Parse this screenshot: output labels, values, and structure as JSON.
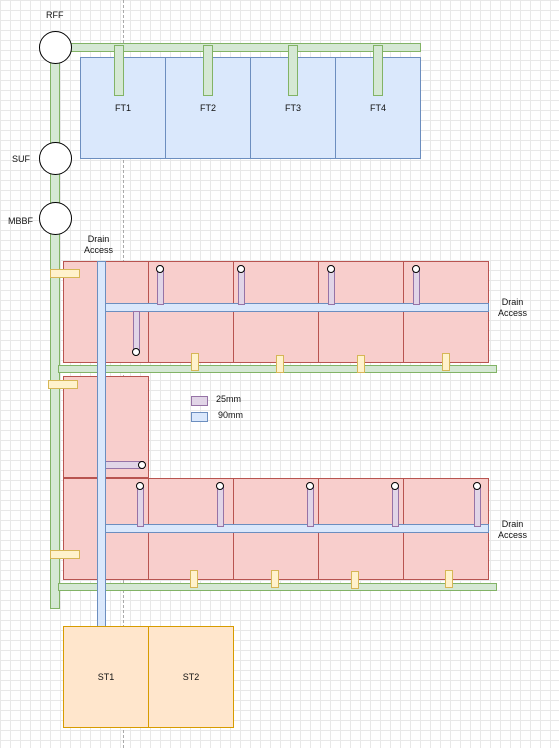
{
  "filters": {
    "rff": "RFF",
    "suf": "SUF",
    "mbbf": "MBBF"
  },
  "tanks": [
    "FT1",
    "FT2",
    "FT3",
    "FT4"
  ],
  "storage": [
    "ST1",
    "ST2"
  ],
  "drain_access": {
    "top": "Drain\nAccess",
    "right_upper": "Drain\nAccess",
    "right_lower": "Drain\nAccess"
  },
  "legend": {
    "small_pipe": "25mm",
    "large_pipe": "90mm"
  },
  "colors": {
    "green": "#d5e8d4",
    "blue": "#dae8fc",
    "red": "#f8cecc",
    "purple": "#e1d5e7",
    "yellow": "#fff2cc",
    "orange": "#ffe6cc"
  }
}
